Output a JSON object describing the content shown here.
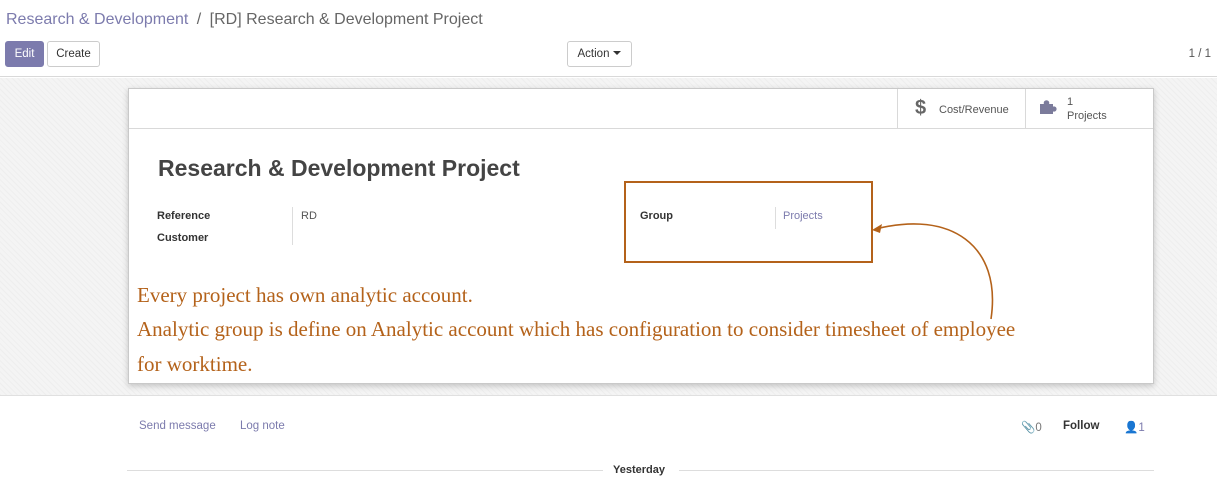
{
  "breadcrumb": {
    "parent": "Research & Development",
    "separator": "/",
    "current": "[RD] Research & Development Project"
  },
  "toolbar": {
    "edit_label": "Edit",
    "create_label": "Create",
    "action_label": "Action",
    "pager": "1 / 1"
  },
  "smart_buttons": {
    "cost_revenue": {
      "icon": "dollar-icon",
      "label": "Cost/Revenue"
    },
    "projects": {
      "icon": "puzzle-icon",
      "value": "1",
      "label": "Projects"
    }
  },
  "record": {
    "title": "Research & Development Project",
    "fields": {
      "reference": {
        "label": "Reference",
        "value": "RD"
      },
      "customer": {
        "label": "Customer",
        "value": ""
      },
      "group": {
        "label": "Group",
        "value": "Projects"
      }
    }
  },
  "annotation": {
    "line1": "Every project has own analytic account.",
    "line2": "Analytic group is define on Analytic account which has configuration to consider timesheet of employee",
    "line3": "for worktime.",
    "color": "#b4621a"
  },
  "chatter": {
    "send_message": "Send message",
    "log_note": "Log note",
    "attachments_count": "0",
    "follow_label": "Follow",
    "followers_count": "1",
    "date_separator": "Yesterday"
  },
  "colors": {
    "accent": "#7c7bad",
    "annotation": "#b4621a"
  }
}
